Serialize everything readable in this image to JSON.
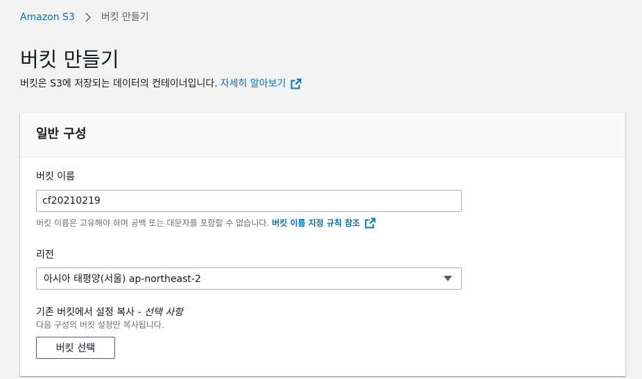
{
  "breadcrumb": {
    "root": "Amazon S3",
    "current": "버킷 만들기",
    "separator_icon": "chevron-right-icon"
  },
  "header": {
    "title": "버킷 만들기",
    "description": "버킷은 S3에 저장되는 데이터의 컨테이너입니다.",
    "learn_more": "자세히 알아보기",
    "learn_more_icon": "external-link-icon"
  },
  "general_config": {
    "title": "일반 구성",
    "bucket_name": {
      "label": "버킷 이름",
      "value": "cf20210219",
      "hint": "버킷 이름은 고유해야 하며 공백 또는 대문자를 포함할 수 없습니다.",
      "hint_link": "버킷 이름 지정 규칙 참조"
    },
    "region": {
      "label": "리전",
      "selected": "아시아 태평양(서울) ap-northeast-2"
    },
    "copy_settings": {
      "label": "기존 버킷에서 설정 복사 -",
      "optional": "선택 사항",
      "hint": "다음 구성의 버킷 설정만 복사됩니다.",
      "button": "버킷 선택"
    }
  },
  "colors": {
    "link": "#0073bb",
    "text": "#16191f",
    "muted": "#687078",
    "background": "#f2f3f3"
  }
}
